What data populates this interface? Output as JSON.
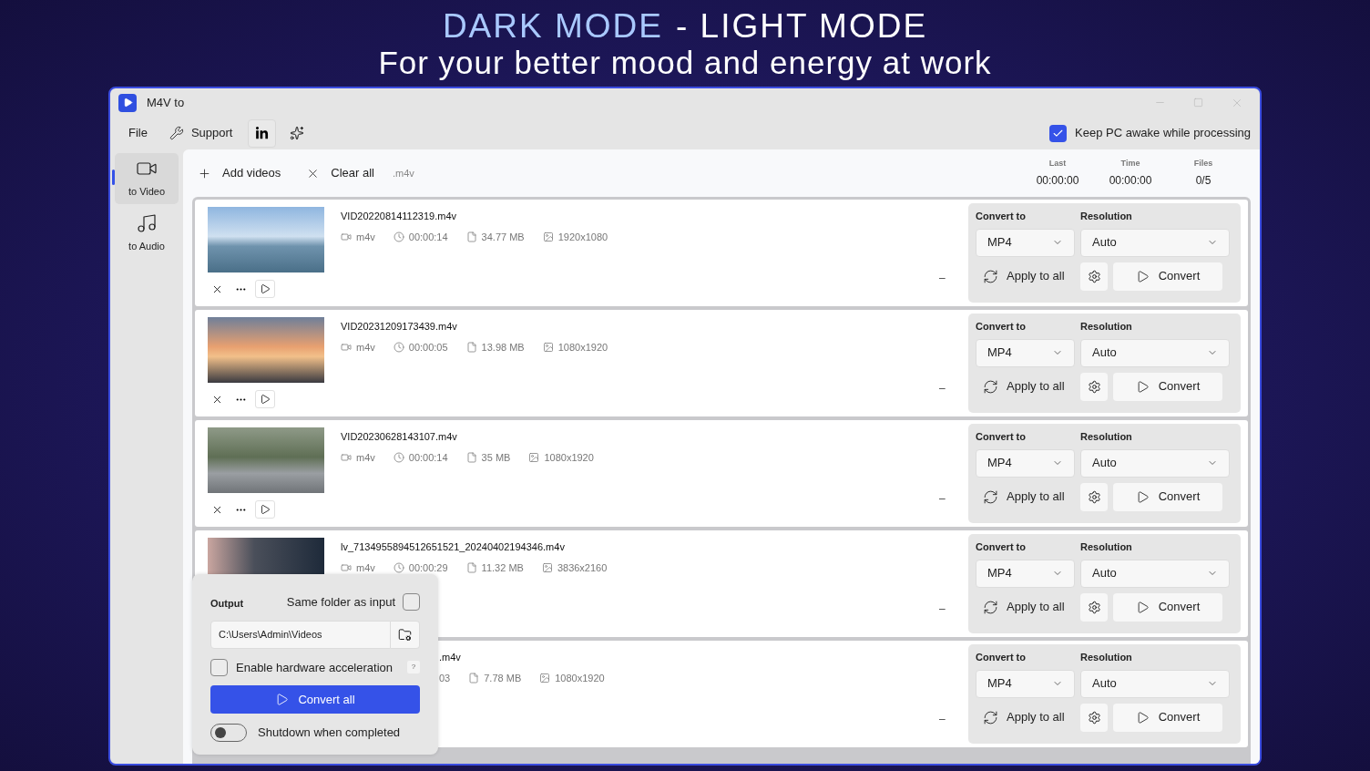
{
  "headline": [
    {
      "text": "DARK MODE",
      "color": "#a9c9ff"
    },
    {
      "text": "- LIGHT MODE",
      "color": "#ffffff"
    }
  ],
  "subtitle": "For your better mood and energy at work",
  "window": {
    "title": "M4V to"
  },
  "menu": [
    {
      "kind": "text",
      "label": "File"
    },
    {
      "kind": "support",
      "label": "Support"
    },
    {
      "kind": "linkedin"
    },
    {
      "kind": "gift"
    }
  ],
  "keep_awake": {
    "label": "Keep PC awake while processing",
    "checked": true
  },
  "sidebar": [
    {
      "kind": "video",
      "label": "to Video",
      "selected": true
    },
    {
      "kind": "audio",
      "label": "to Audio",
      "selected": false
    }
  ],
  "toolbar": {
    "add": "Add videos",
    "clear": "Clear all",
    "filter": ".m4v"
  },
  "stats": [
    {
      "label": "Last",
      "value": "00:00:00"
    },
    {
      "label": "Time",
      "value": "00:00:00"
    },
    {
      "label": "Files",
      "value": "0/5"
    }
  ],
  "rows": [
    {
      "thumbnail_visible": true,
      "name": "VID20220814112319.m4v",
      "meta": [
        {
          "kind": "format",
          "text": "m4v"
        },
        {
          "kind": "duration",
          "text": "00:00:14"
        },
        {
          "kind": "size",
          "text": "34.77 MB"
        },
        {
          "kind": "resolution",
          "text": "1920x1080"
        }
      ],
      "controls": true,
      "status": "–",
      "convert_to_label": "Convert to",
      "convert_to": "MP4",
      "resolution_label": "Resolution",
      "resolution": "Auto",
      "apply": "Apply to all",
      "convert": "Convert"
    },
    {
      "thumbnail_visible": true,
      "name": "VID20231209173439.m4v",
      "meta": [
        {
          "kind": "format",
          "text": "m4v"
        },
        {
          "kind": "duration",
          "text": "00:00:05"
        },
        {
          "kind": "size",
          "text": "13.98 MB"
        },
        {
          "kind": "resolution",
          "text": "1080x1920"
        }
      ],
      "controls": true,
      "status": "–",
      "convert_to_label": "Convert to",
      "convert_to": "MP4",
      "resolution_label": "Resolution",
      "resolution": "Auto",
      "apply": "Apply to all",
      "convert": "Convert"
    },
    {
      "thumbnail_visible": true,
      "name": "VID20230628143107.m4v",
      "meta": [
        {
          "kind": "format",
          "text": "m4v"
        },
        {
          "kind": "duration",
          "text": "00:00:14"
        },
        {
          "kind": "size",
          "text": "35 MB"
        },
        {
          "kind": "resolution",
          "text": "1080x1920"
        }
      ],
      "controls": true,
      "status": "–",
      "convert_to_label": "Convert to",
      "convert_to": "MP4",
      "resolution_label": "Resolution",
      "resolution": "Auto",
      "apply": "Apply to all",
      "convert": "Convert"
    },
    {
      "thumbnail_visible": true,
      "name": "lv_7134955894512651521_20240402194346.m4v",
      "meta": [
        {
          "kind": "format",
          "text": "m4v"
        },
        {
          "kind": "duration",
          "text": "00:00:29"
        },
        {
          "kind": "size",
          "text": "11.32 MB"
        },
        {
          "kind": "resolution",
          "text": "3836x2160"
        }
      ],
      "controls": false,
      "status": "–",
      "convert_to_label": "Convert to",
      "convert_to": "MP4",
      "resolution_label": "Resolution",
      "resolution": "Auto",
      "apply": "Apply to all",
      "convert": "Convert"
    },
    {
      "thumbnail_visible": false,
      "name": ".m4v",
      "meta": [
        {
          "kind": "partial",
          "text": "03"
        },
        {
          "kind": "size",
          "text": "7.78 MB"
        },
        {
          "kind": "resolution",
          "text": "1080x1920"
        }
      ],
      "controls": false,
      "status": "–",
      "convert_to_label": "Convert to",
      "convert_to": "MP4",
      "resolution_label": "Resolution",
      "resolution": "Auto",
      "apply": "Apply to all",
      "convert": "Convert"
    }
  ],
  "output": {
    "label": "Output",
    "same_folder_label": "Same folder as input",
    "same_folder": false,
    "path": "C:\\Users\\Admin\\Videos",
    "hw_label": "Enable hardware acceleration",
    "hw": false,
    "help": "?",
    "convert_all": "Convert all",
    "shutdown_label": "Shutdown when completed",
    "shutdown": false
  }
}
